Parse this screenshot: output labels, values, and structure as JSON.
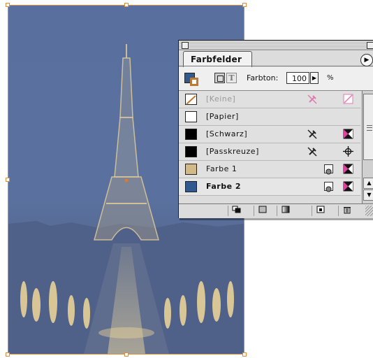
{
  "palette": {
    "tab_title": "Farbfelder",
    "tint_label": "Farbton:",
    "tint_value": "100",
    "tint_unit": "%",
    "menu_icon": "triangle-right-icon",
    "swatches": [
      {
        "label": "[Keine]",
        "color": "#ffffff",
        "dim": true,
        "selected": false
      },
      {
        "label": "[Papier]",
        "color": "#ffffff",
        "dim": false,
        "selected": false
      },
      {
        "label": "[Schwarz]",
        "color": "#000000",
        "dim": false,
        "selected": false
      },
      {
        "label": "[Passkreuze]",
        "color": "#000000",
        "dim": false,
        "selected": false
      },
      {
        "label": "Farbe 1",
        "color": "#d3b98a",
        "dim": false,
        "selected": false
      },
      {
        "label": "Farbe 2",
        "color": "#305a8f",
        "dim": false,
        "selected": true
      }
    ]
  },
  "colors": {
    "selection_frame": "#e08a3a",
    "duotone_blue": "#305a8f",
    "duotone_gold": "#d3b98a"
  }
}
